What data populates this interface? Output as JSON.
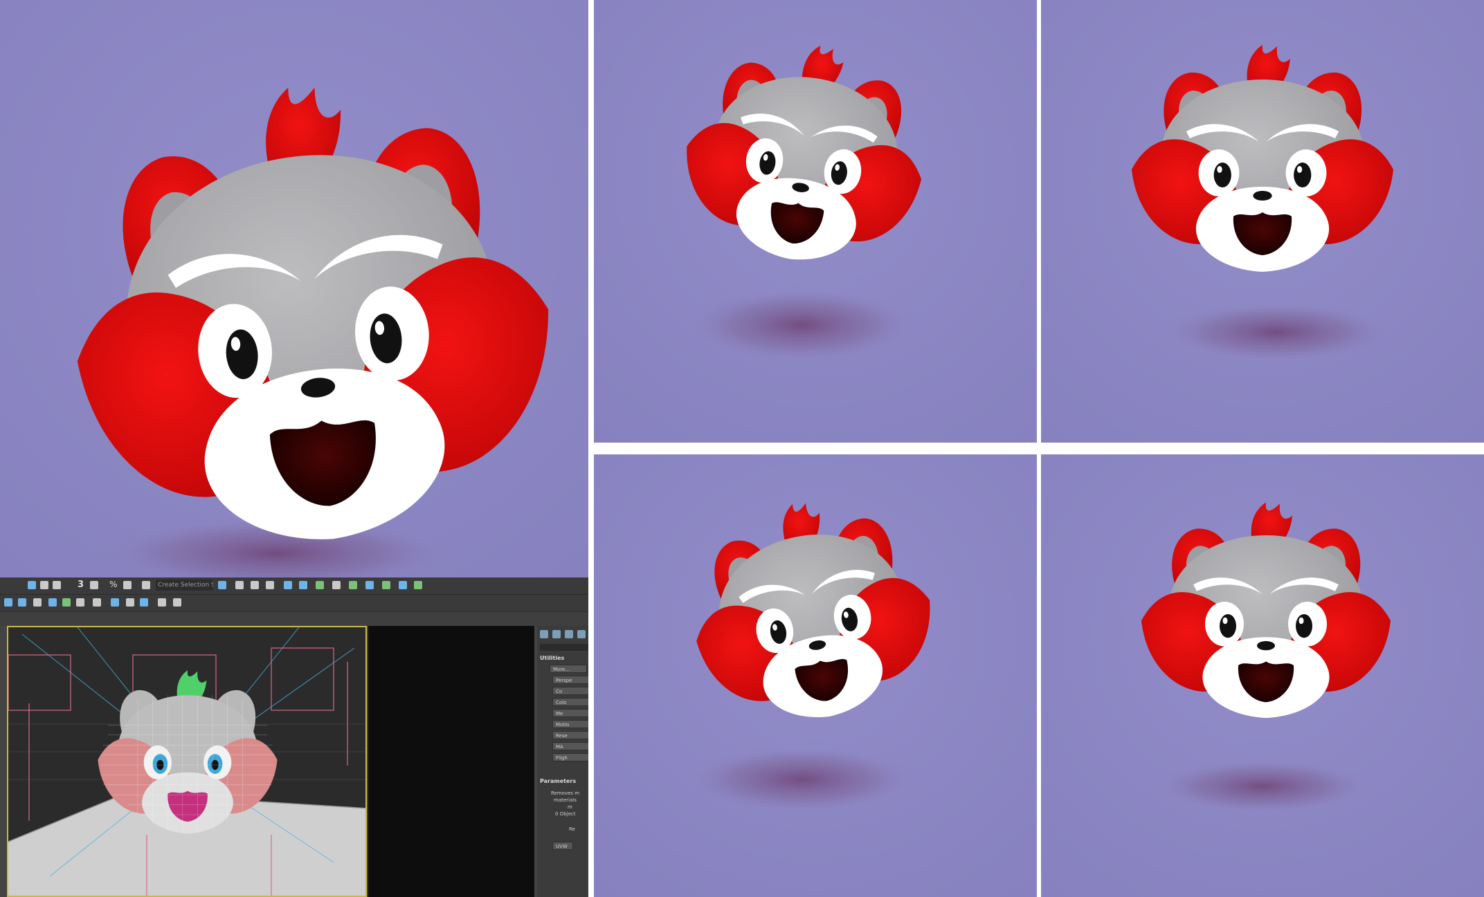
{
  "title": "",
  "colors": {
    "background_purple": "#8d88c4",
    "character_red": "#e60b0b",
    "character_grey": "#a9a9ad",
    "character_white": "#ffffff",
    "max_ui_dark": "#444444",
    "viewport_border": "#c8b84a"
  },
  "panels": [
    {
      "name": "main-render",
      "view": "three-quarter-left"
    },
    {
      "name": "render-top-middle",
      "view": "three-quarter-right"
    },
    {
      "name": "render-top-right",
      "view": "front"
    },
    {
      "name": "render-bottom-middle",
      "view": "side-right"
    },
    {
      "name": "render-bottom-right",
      "view": "front-slight-left"
    }
  ],
  "max_ui": {
    "selection_set_placeholder": "Create Selection Se",
    "toolbar_snap_label": "3",
    "toolbar_percent_label": "%",
    "utilities_title": "Utilities",
    "more_button": "More...",
    "utility_buttons": [
      "Perspe",
      "Co",
      "Colo",
      "Me",
      "Motio",
      "Rese",
      "MA",
      "Fligh"
    ],
    "parameters_title": "Parameters",
    "param_lines": [
      "Removes m",
      "materials",
      "m",
      "0 Object"
    ],
    "reset_label": "Re",
    "uvw_button": "UVW"
  }
}
